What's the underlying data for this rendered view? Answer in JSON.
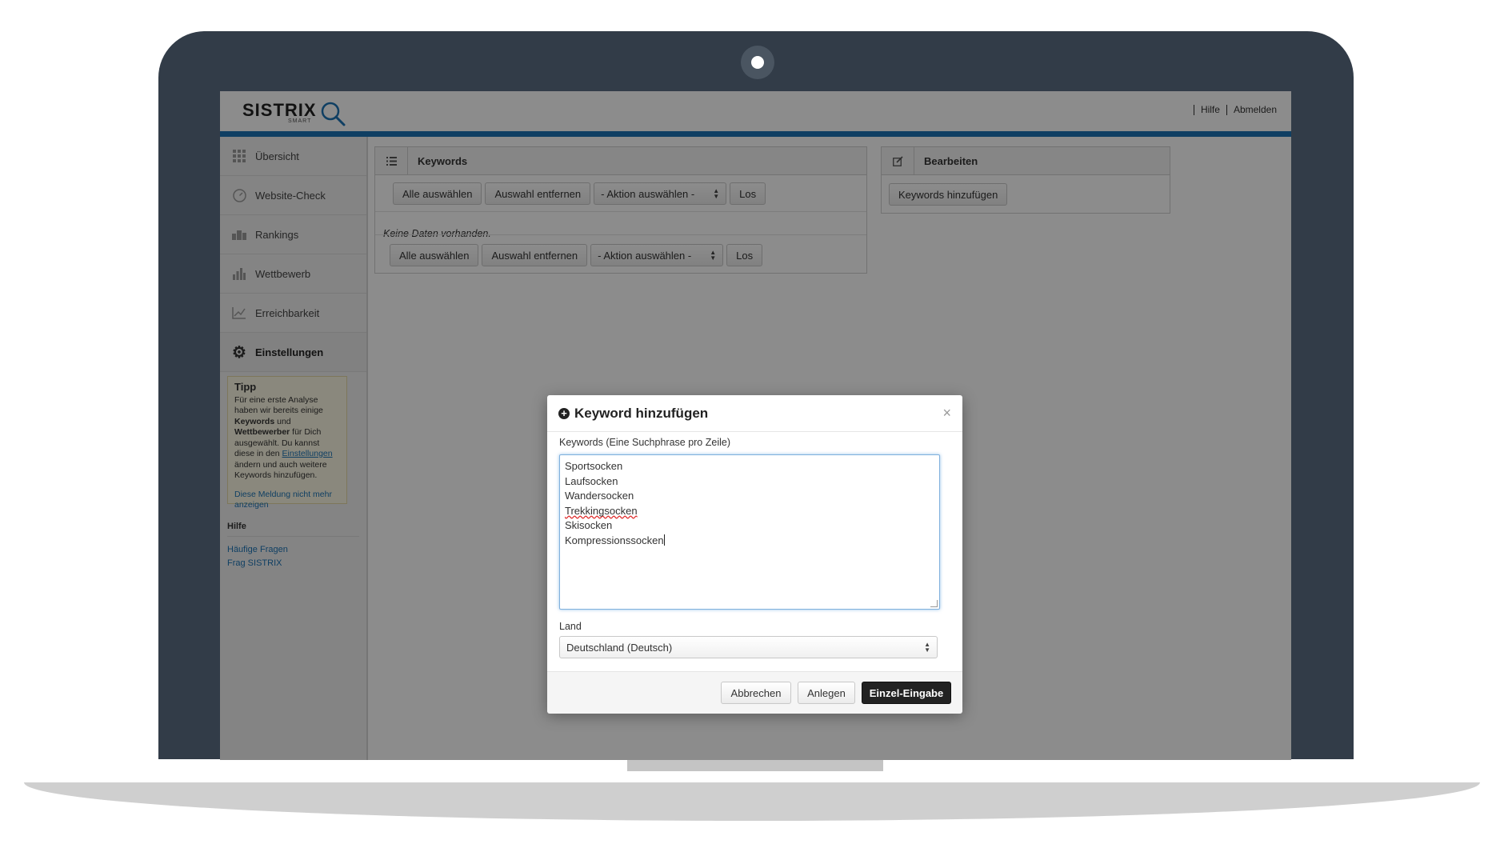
{
  "app": {
    "logo_text": "SISTRIX",
    "logo_sub": "SMART",
    "links": [
      "Hilfe",
      "Abmelden"
    ]
  },
  "sidebar": {
    "items": [
      {
        "label": "Übersicht",
        "icon": "grid-icon"
      },
      {
        "label": "Website-Check",
        "icon": "gauge-icon"
      },
      {
        "label": "Rankings",
        "icon": "rankings-icon"
      },
      {
        "label": "Wettbewerb",
        "icon": "bar-chart-icon"
      },
      {
        "label": "Erreichbarkeit",
        "icon": "line-chart-icon"
      },
      {
        "label": "Einstellungen",
        "icon": "gear-icon"
      }
    ],
    "tip": {
      "title": "Tipp",
      "text_1": "Für eine erste Analyse haben wir bereits einige ",
      "bold_1": "Keywords",
      "text_2": " und ",
      "bold_2": "Wettbewerber",
      "text_3": " für Dich ausgewählt. Du kannst diese in den ",
      "link": "Einstellungen",
      "text_4": " ändern und auch weitere Keywords hinzufügen.",
      "dismiss": "Diese Meldung nicht mehr anzeigen"
    },
    "help_title": "Hilfe",
    "help_links": [
      "Häufige Fragen",
      "Frag SISTRIX"
    ]
  },
  "keywords_panel": {
    "title": "Keywords",
    "select_all": "Alle auswählen",
    "remove_selection": "Auswahl entfernen",
    "action_select": "- Aktion auswählen -",
    "go": "Los",
    "no_data": "Keine Daten vorhanden."
  },
  "edit_panel": {
    "title": "Bearbeiten",
    "add_keywords": "Keywords hinzufügen"
  },
  "modal": {
    "title": "Keyword hinzufügen",
    "close": "×",
    "keywords_label": "Keywords (Eine Suchphrase pro Zeile)",
    "keywords": [
      "Sportsocken",
      "Laufsocken",
      "Wandersocken",
      "Trekkingsocken",
      "Skisocken",
      "Kompressionssocken"
    ],
    "country_label": "Land",
    "country_value": "Deutschland (Deutsch)",
    "cancel": "Abbrechen",
    "create": "Anlegen",
    "single_entry": "Einzel-Eingabe"
  },
  "colors": {
    "accent": "#1c73b5",
    "bezel": "#323c48",
    "primary_button": "#222222"
  }
}
